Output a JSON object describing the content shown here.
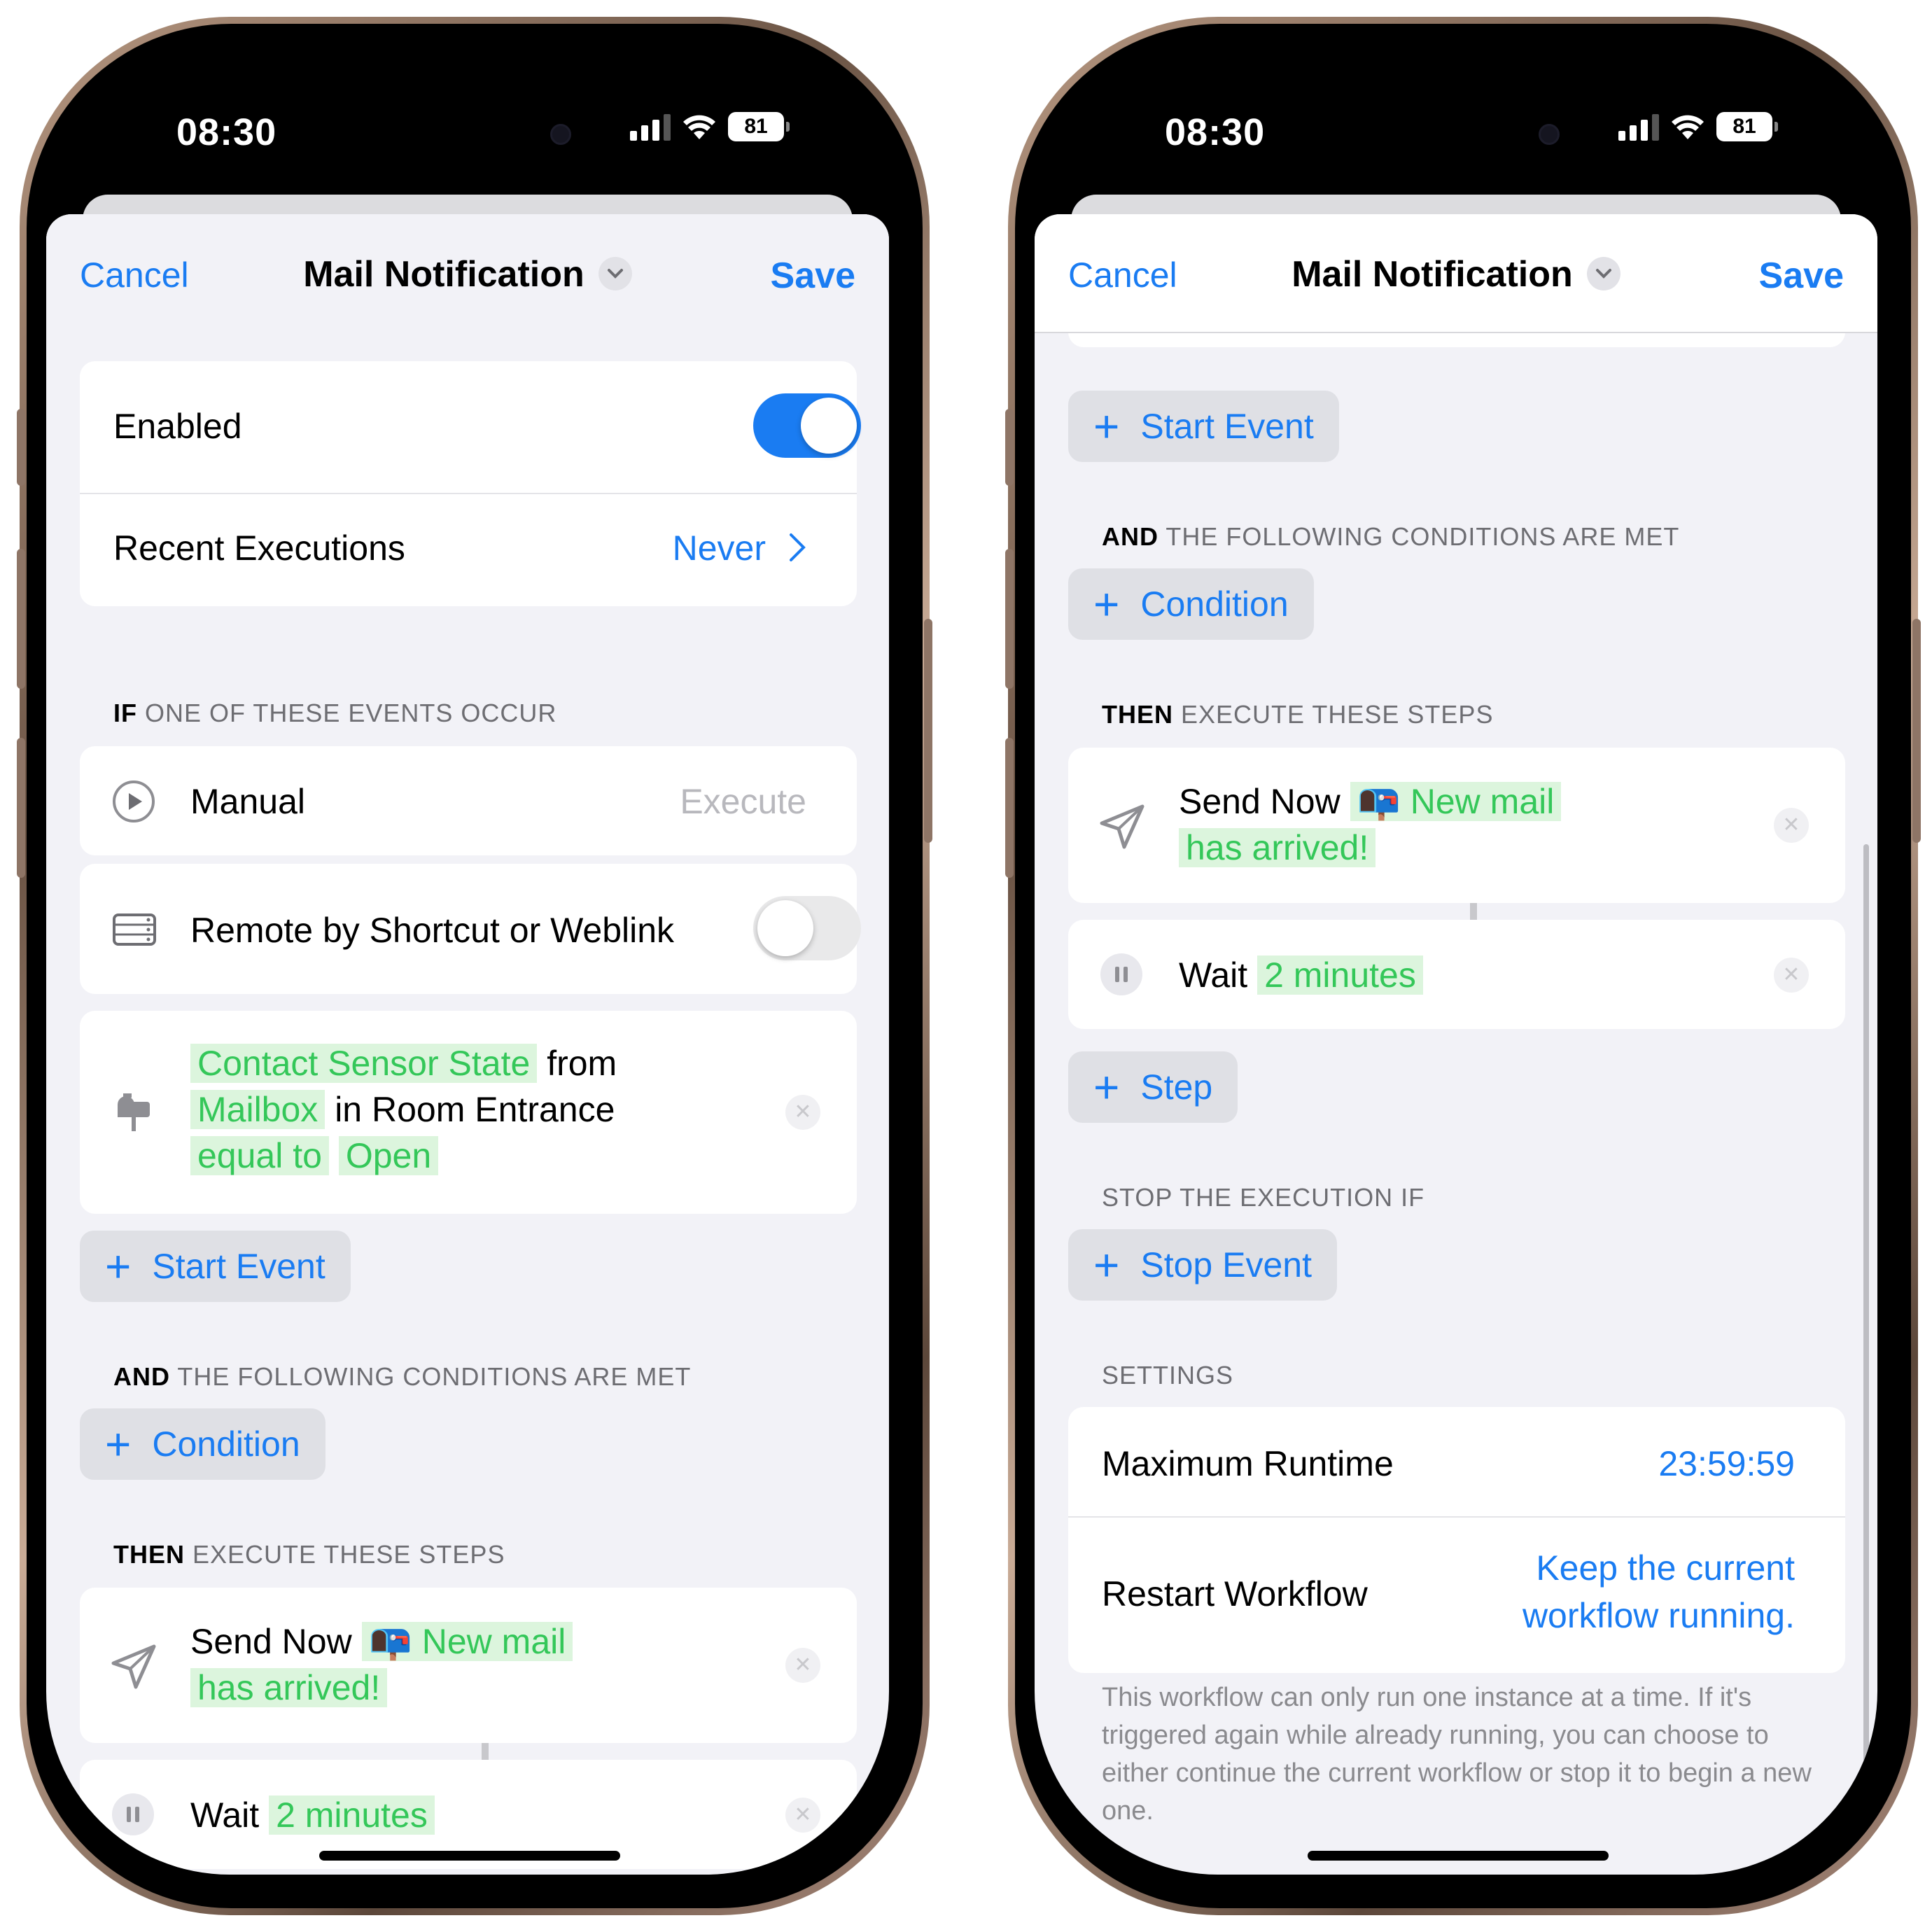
{
  "status": {
    "time": "08:30",
    "battery": "81"
  },
  "nav": {
    "cancel": "Cancel",
    "title": "Mail Notification",
    "save": "Save"
  },
  "general": {
    "enabled_label": "Enabled",
    "enabled": true,
    "recent_label": "Recent Executions",
    "recent_value": "Never"
  },
  "events": {
    "header_bold": "IF",
    "header_rest": " ONE OF THESE EVENTS OCCUR",
    "manual_label": "Manual",
    "manual_action": "Execute",
    "remote_label": "Remote by Shortcut or Weblink",
    "remote_enabled": false,
    "sensor": {
      "characteristic": "Contact Sensor State",
      "from": "from",
      "accessory": "Mailbox",
      "room": "in Room Entrance",
      "operator": "equal to",
      "value": "Open"
    },
    "add_label": "Start Event"
  },
  "conditions": {
    "header_bold": "AND",
    "header_rest": " THE FOLLOWING CONDITIONS ARE MET",
    "add_label": "Condition"
  },
  "steps": {
    "header_bold": "THEN",
    "header_rest": " EXECUTE THESE STEPS",
    "send_label": "Send Now",
    "send_message_line1": "📭 New mail",
    "send_message_line2": "has arrived!",
    "wait_label": "Wait",
    "wait_value": "2 minutes",
    "add_label": "Step"
  },
  "stop": {
    "header": "STOP THE EXECUTION IF",
    "add_label": "Stop Event"
  },
  "settings": {
    "header": "SETTINGS",
    "max_runtime_label": "Maximum Runtime",
    "max_runtime_value": "23:59:59",
    "restart_label": "Restart Workflow",
    "restart_value_line1": "Keep the current",
    "restart_value_line2": "workflow running.",
    "footnote": "This workflow can only run one instance at a time. If it's triggered again while already running, you can choose to either continue the current workflow or stop it to begin a new one."
  },
  "colors": {
    "accent": "#1a7cf2",
    "token_bg": "#dcf5dd",
    "token_text": "#34c759",
    "background": "#f2f2f7"
  }
}
